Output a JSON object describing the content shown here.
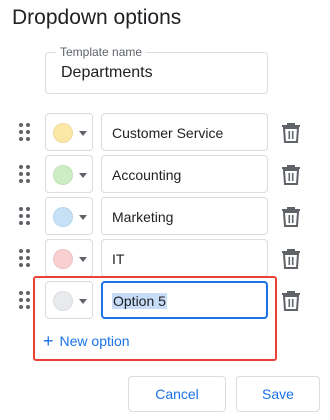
{
  "title": "Dropdown options",
  "template": {
    "label": "Template name",
    "value": "Departments"
  },
  "options": [
    {
      "label": "Customer Service",
      "color": "#fce8a6"
    },
    {
      "label": "Accounting",
      "color": "#cdeec5"
    },
    {
      "label": "Marketing",
      "color": "#c6e1f7"
    },
    {
      "label": "IT",
      "color": "#f9cfcf"
    },
    {
      "label": "Option 5",
      "color": "#e8eaed"
    }
  ],
  "new_option_label": "New option",
  "buttons": {
    "cancel": "Cancel",
    "save": "Save"
  },
  "colors": {
    "accent": "#1a73e8",
    "highlight": "#ea4335",
    "selection": "#c7dcf8"
  }
}
